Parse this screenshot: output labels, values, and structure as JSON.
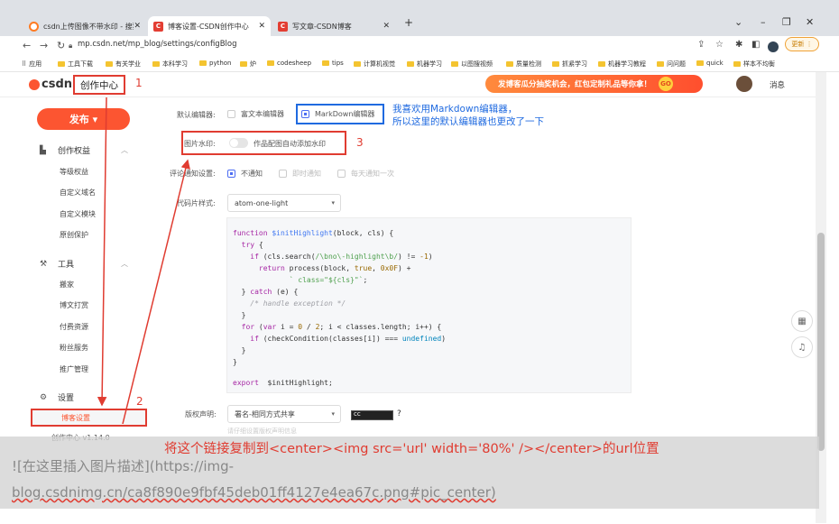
{
  "browser": {
    "tabs": [
      {
        "title": "csdn上传图像不带水印 - 搜狗搜",
        "favicon": "sogou-icon"
      },
      {
        "title": "博客设置-CSDN创作中心",
        "favicon": "csdn-icon"
      },
      {
        "title": "写文章-CSDN博客",
        "favicon": "csdn-icon"
      }
    ],
    "new_tab": "+",
    "url": "mp.csdn.net/mp_blog/settings/configBlog",
    "extension_label": "更新 ⋮",
    "profile_badge": "账户",
    "bookmarks": [
      "应用",
      "工具下载",
      "有关学业",
      "本科学习",
      "python",
      "炉",
      "codesheep",
      "tips",
      "计算机视觉",
      "机器学习",
      "以图搜视频",
      "质量检测",
      "抓紧学习",
      "机器学习教程",
      "问问题",
      "quick",
      "样本不均衡"
    ]
  },
  "header": {
    "logo": "csdn",
    "center_label": "创作中心",
    "annotation_1": "1",
    "banner": "发博客瓜分抽奖机会，红包定制礼品等你拿！",
    "banner_gift": "GO",
    "messages": "消息"
  },
  "sidebar": {
    "publish": "发布 ▾",
    "section_rights": "创作权益",
    "rights_items": [
      "等级权益",
      "自定义域名",
      "自定义模块",
      "原创保护"
    ],
    "section_tools": "工具",
    "tools_items": [
      "搬家",
      "博文打赏",
      "付费资源",
      "粉丝服务",
      "推广管理"
    ],
    "section_settings": "设置",
    "blog_settings": "博客设置",
    "annotation_2": "2",
    "version": "创作中心 v1.14.0"
  },
  "settings": {
    "editor_label": "默认编辑器:",
    "editor_rich": "富文本编辑器",
    "editor_md": "MarkDown编辑器",
    "editor_note_line1": "我喜欢用Markdown编辑器，",
    "editor_note_line2": "所以这里的默认编辑器也更改了一下",
    "watermark_label": "图片水印:",
    "watermark_text": "作品配图自动添加水印",
    "annotation_3": "3",
    "notify_label": "评论通知设置:",
    "notify_options": [
      "不通知",
      "即时通知",
      "每天通知一次"
    ],
    "code_style_label": "代码片样式:",
    "code_style_value": "atom-one-light",
    "copyright_label": "版权声明:",
    "copyright_value": "署名-相同方式共享",
    "copyright_help": "?",
    "tiny_hint": "请仔细设置版权声明信息"
  },
  "code_preview": [
    "function $initHighlight(block, cls) {",
    "  try {",
    "    if (cls.search(/\\bno\\-highlight\\b/) != -1)",
    "      return process(block, true, 0x0F) +",
    "             ` class=\"${cls}\"`;",
    "  } catch (e) {",
    "    /* handle exception */",
    "  }",
    "  for (var i = 0 / 2; i < classes.length; i++) {",
    "    if (checkCondition(classes[i]) === undefined)",
    "  }",
    "}",
    "",
    "export  $initHighlight;"
  ],
  "overlay": {
    "instruction": "将这个链接复制到<center><img src='url' width='80%' /></center>的url位置",
    "md_line1": "![在这里插入图片描述](https://img-",
    "md_line2": "blog.csdnimg.cn/ca8f890e9fbf45deb01ff4127e4ea67c.png#pic_center)"
  },
  "colors": {
    "brand": "#fc5531",
    "annotation_red": "#e03c31",
    "annotation_blue": "#1f6ae0"
  }
}
